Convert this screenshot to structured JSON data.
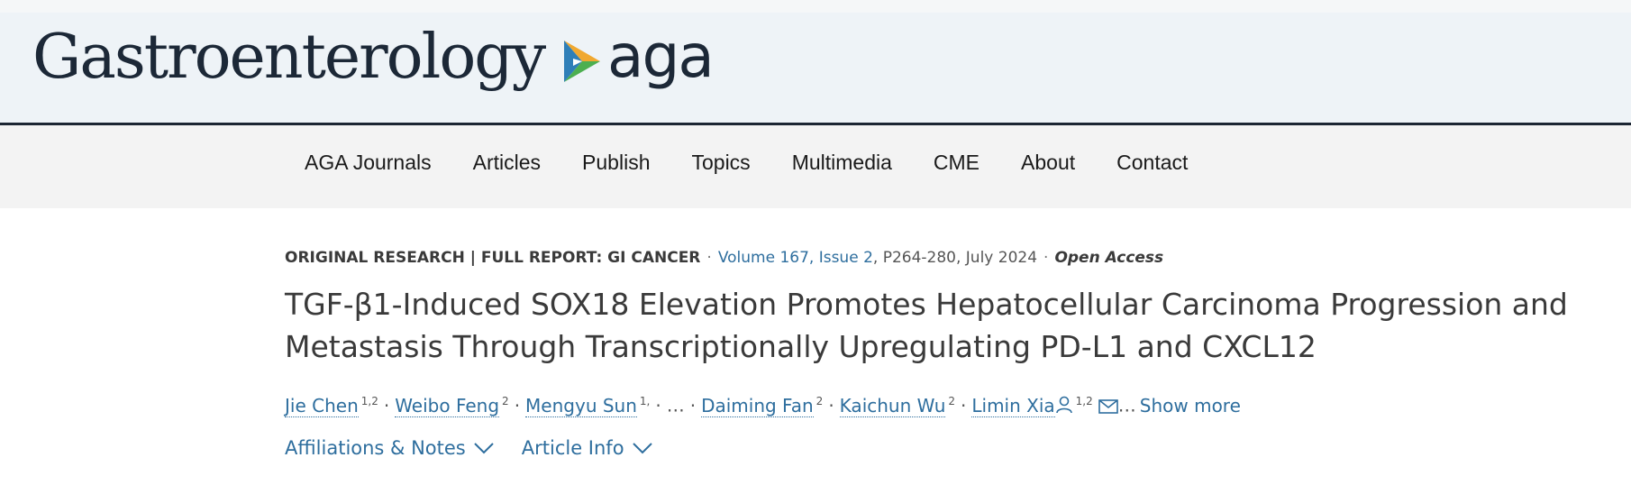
{
  "header": {
    "journal_title": "Gastroenterology",
    "logo_text": "aga",
    "logo_icon": "aga-triangle-icon",
    "colors": {
      "logo_orange": "#f0a830",
      "logo_blue": "#2f7fb8",
      "logo_green": "#4caf50",
      "brand_text": "#1c2837"
    }
  },
  "nav": {
    "items": [
      {
        "label": "AGA Journals"
      },
      {
        "label": "Articles"
      },
      {
        "label": "Publish"
      },
      {
        "label": "Topics"
      },
      {
        "label": "Multimedia"
      },
      {
        "label": "CME"
      },
      {
        "label": "About"
      },
      {
        "label": "Contact"
      }
    ]
  },
  "article": {
    "category": "ORIGINAL RESEARCH | FULL REPORT: GI CANCER",
    "volume_link": "Volume 167, Issue 2",
    "pages_date": ", P264-280, July 2024",
    "access": "Open Access",
    "title": "TGF-β1-Induced SOX18 Elevation Promotes Hepatocellular Carcinoma Progression and Metastasis Through Transcriptionally Upregulating PD-L1 and CXCL12",
    "authors": [
      {
        "name": "Jie Chen",
        "sup": "1,2"
      },
      {
        "name": "Weibo Feng",
        "sup": "2"
      },
      {
        "name": "Mengyu Sun",
        "sup": "1,"
      },
      {
        "name": "Daiming Fan",
        "sup": "2"
      },
      {
        "name": "Kaichun Wu",
        "sup": "2"
      },
      {
        "name": "Limin Xia",
        "sup": "1,2"
      }
    ],
    "ellipsis": "…",
    "show_more_ellipsis": "…",
    "show_more": "Show more",
    "affiliations": "Affiliations & Notes",
    "article_info": "Article Info",
    "colors": {
      "link": "#2e6e9e",
      "text": "#3a3a3a"
    }
  }
}
